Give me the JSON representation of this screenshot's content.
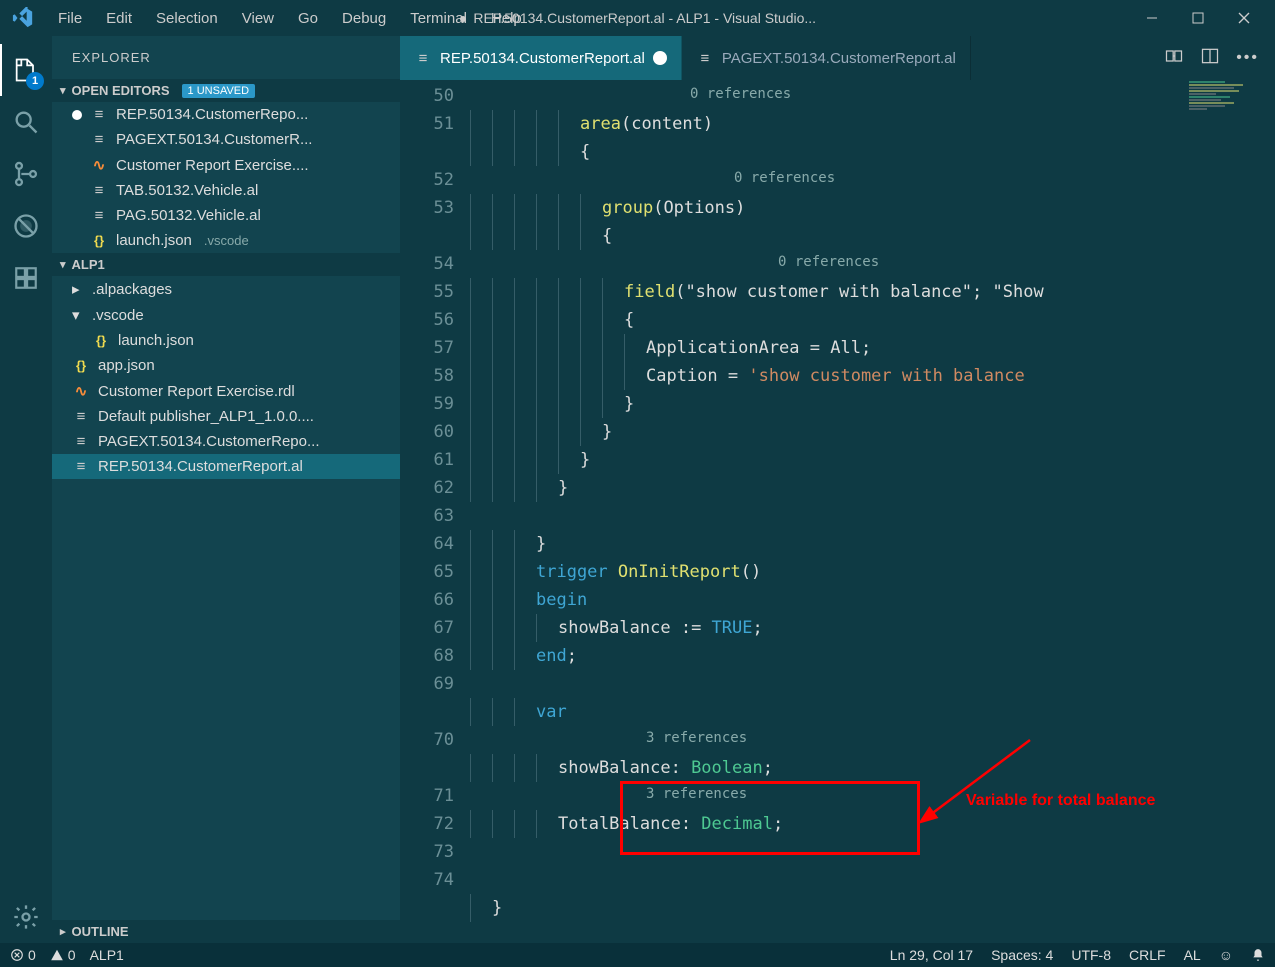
{
  "titlebar": {
    "title": "REP.50134.CustomerReport.al - ALP1 - Visual Studio...",
    "dirty_dot": "●"
  },
  "menu": {
    "file": "File",
    "edit": "Edit",
    "selection": "Selection",
    "view": "View",
    "go": "Go",
    "debug": "Debug",
    "terminal": "Terminal",
    "help": "Help"
  },
  "activitybar": {
    "explorer_badge": "1"
  },
  "sidebar": {
    "title": "EXPLORER",
    "open_editors": {
      "label": "OPEN EDITORS",
      "badge": "1 UNSAVED"
    },
    "open_editors_items": [
      {
        "dirty": true,
        "icon": "lines",
        "label": "REP.50134.CustomerRepo..."
      },
      {
        "dirty": false,
        "icon": "lines",
        "label": "PAGEXT.50134.CustomerR..."
      },
      {
        "dirty": false,
        "icon": "rss",
        "label": "Customer Report Exercise...."
      },
      {
        "dirty": false,
        "icon": "lines",
        "label": "TAB.50132.Vehicle.al"
      },
      {
        "dirty": false,
        "icon": "lines",
        "label": "PAG.50132.Vehicle.al"
      },
      {
        "dirty": false,
        "icon": "json",
        "label": "launch.json",
        "suffix": ".vscode"
      }
    ],
    "project": {
      "label": "ALP1"
    },
    "project_items": [
      {
        "chev": "▸",
        "icon": "",
        "label": ".alpackages",
        "indent": 1
      },
      {
        "chev": "▾",
        "icon": "",
        "label": ".vscode",
        "indent": 1
      },
      {
        "chev": "",
        "icon": "json",
        "label": "launch.json",
        "indent": 2
      },
      {
        "chev": "",
        "icon": "json",
        "label": "app.json",
        "indent": 1
      },
      {
        "chev": "",
        "icon": "rss",
        "label": "Customer Report Exercise.rdl",
        "indent": 1
      },
      {
        "chev": "",
        "icon": "lines",
        "label": "Default publisher_ALP1_1.0.0....",
        "indent": 1
      },
      {
        "chev": "",
        "icon": "lines",
        "label": "PAGEXT.50134.CustomerRepo...",
        "indent": 1
      },
      {
        "chev": "",
        "icon": "lines",
        "label": "REP.50134.CustomerReport.al",
        "indent": 1,
        "selected": true
      }
    ],
    "outline": {
      "label": "OUTLINE"
    }
  },
  "tabs": {
    "tab1": "REP.50134.CustomerReport.al",
    "tab2": "PAGEXT.50134.CustomerReport.al"
  },
  "code": {
    "ref0": "0 references",
    "ref3": "3 references",
    "l50a": "area",
    "l50b": "(",
    "l50c": "content",
    "l50d": ")",
    "l51": "{",
    "l52a": "group",
    "l52b": "(",
    "l52c": "Options",
    "l52d": ")",
    "l53": "{",
    "l54a": "field",
    "l54b": "(",
    "l54c": "\"show customer with balance\"",
    "l54d": "; ",
    "l54e": "\"Show",
    "l55": "{",
    "l56a": "ApplicationArea = ",
    "l56b": "All",
    "l56c": ";",
    "l57a": "Caption = ",
    "l57b": "'show customer with balance",
    "l58": "}",
    "l59": "}",
    "l60": "}",
    "l61": "}",
    "l63": "}",
    "l64a": "trigger",
    "l64b": " OnInitReport",
    "l64c": "()",
    "l65": "begin",
    "l66a": "showBalance ",
    "l66b": ":=",
    "l66c": " TRUE",
    "l66d": ";",
    "l67a": "end",
    "l67b": ";",
    "l69": "var",
    "l70a": "showBalance: ",
    "l70b": "Boolean",
    "l70c": ";",
    "l71a": "TotalBalance: ",
    "l71b": "Decimal",
    "l71c": ";",
    "l74": "}"
  },
  "line_numbers": [
    "50",
    "51",
    "",
    "52",
    "53",
    "",
    "54",
    "55",
    "56",
    "57",
    "58",
    "59",
    "60",
    "61",
    "62",
    "63",
    "64",
    "65",
    "66",
    "67",
    "68",
    "69",
    "",
    "70",
    "",
    "71",
    "72",
    "73",
    "74"
  ],
  "annotation": {
    "text": "Variable for total balance"
  },
  "statusbar": {
    "errors": "0",
    "warnings": "0",
    "project": "ALP1",
    "lncol": "Ln 29, Col 17",
    "spaces": "Spaces: 4",
    "encoding": "UTF-8",
    "eol": "CRLF",
    "lang": "AL"
  }
}
